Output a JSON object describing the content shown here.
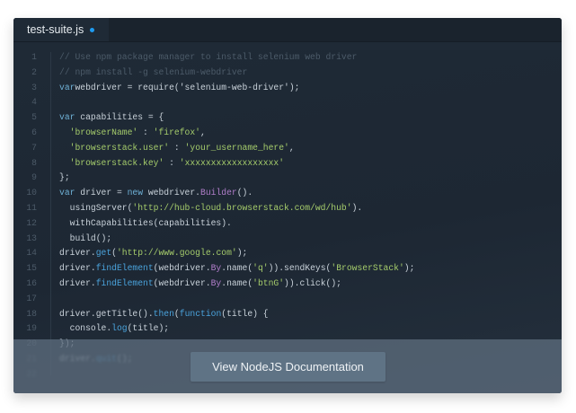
{
  "tab": {
    "filename": "test-suite.js",
    "modified_indicator_color": "#1e9bf0"
  },
  "colors": {
    "keyword": "#6fb1d6",
    "string": "#a5cc6b",
    "class": "#b07dc9",
    "method": "#4aa3dc",
    "comment": "#4c5b69"
  },
  "code": {
    "lines": [
      {
        "num": "1",
        "tokens": [
          [
            "c",
            "// Use npm package manager to install selenium web driver"
          ]
        ]
      },
      {
        "num": "2",
        "tokens": [
          [
            "c",
            "// npm install -g selenium-webdriver"
          ]
        ]
      },
      {
        "num": "3",
        "tokens": [
          [
            "k",
            "var"
          ],
          [
            "",
            "webdriver = require("
          ],
          [
            "",
            "'selenium-web-driver'"
          ],
          [
            "",
            ");"
          ]
        ]
      },
      {
        "num": "4",
        "tokens": []
      },
      {
        "num": "5",
        "tokens": [
          [
            "k",
            "var"
          ],
          [
            "",
            " capabilities = {"
          ]
        ]
      },
      {
        "num": "6",
        "tokens": [
          [
            "",
            "  "
          ],
          [
            "s",
            "'browserName'"
          ],
          [
            "",
            " : "
          ],
          [
            "s",
            "'firefox'"
          ],
          [
            "",
            ","
          ]
        ]
      },
      {
        "num": "7",
        "tokens": [
          [
            "",
            "  "
          ],
          [
            "s",
            "'browserstack.user'"
          ],
          [
            "",
            " : "
          ],
          [
            "s",
            "'your_username_here'"
          ],
          [
            "",
            ","
          ]
        ]
      },
      {
        "num": "8",
        "tokens": [
          [
            "",
            "  "
          ],
          [
            "s",
            "'browserstack.key'"
          ],
          [
            "",
            " : "
          ],
          [
            "s",
            "'xxxxxxxxxxxxxxxxxx'"
          ]
        ]
      },
      {
        "num": "9",
        "tokens": [
          [
            "",
            "};"
          ]
        ]
      },
      {
        "num": "10",
        "tokens": []
      },
      {
        "num": "11",
        "tokens": [
          [
            "k",
            "var"
          ],
          [
            "",
            " driver = "
          ],
          [
            "k",
            "new"
          ],
          [
            "",
            " webdriver."
          ],
          [
            "p",
            "Builder"
          ],
          [
            "",
            "()."
          ]
        ]
      },
      {
        "num": "12",
        "tokens": [
          [
            "",
            "  usingServer("
          ],
          [
            "s",
            "'http://hub-cloud.browserstack.com/wd/hub'"
          ],
          [
            "",
            ")."
          ]
        ]
      },
      {
        "num": "13",
        "tokens": [
          [
            "",
            "  withCapabilities(capabilities)."
          ]
        ]
      },
      {
        "num": "14",
        "tokens": [
          [
            "",
            "  build();"
          ]
        ]
      },
      {
        "num": "15",
        "tokens": []
      },
      {
        "num": "16",
        "tokens": [
          [
            "",
            "driver."
          ],
          [
            "f",
            "get"
          ],
          [
            "",
            "("
          ],
          [
            "s",
            "'http://www.google.com'"
          ],
          [
            "",
            ");"
          ]
        ]
      },
      {
        "num": "17",
        "tokens": [
          [
            "",
            "driver."
          ],
          [
            "f",
            "findElement"
          ],
          [
            "",
            "(webdriver."
          ],
          [
            "p",
            "By"
          ],
          [
            "",
            ".name("
          ],
          [
            "s",
            "'q'"
          ],
          [
            "",
            "))."
          ],
          [
            "",
            "sendKeys("
          ],
          [
            "s",
            "'BrowserStack'"
          ],
          [
            "",
            ");"
          ]
        ]
      },
      {
        "num": "18",
        "tokens": [
          [
            "",
            "driver."
          ],
          [
            "f",
            "findElement"
          ],
          [
            "",
            "(webdriver."
          ],
          [
            "p",
            "By"
          ],
          [
            "",
            ".name("
          ],
          [
            "s",
            "'btnG'"
          ],
          [
            "",
            ")).click();"
          ]
        ]
      },
      {
        "num": "19",
        "tokens": []
      },
      {
        "num": "20",
        "tokens": [
          [
            "",
            "driver.getTitle()."
          ],
          [
            "f",
            "then"
          ],
          [
            "",
            "("
          ],
          [
            "f",
            "function"
          ],
          [
            "",
            "(title) {"
          ]
        ]
      },
      {
        "num": "21",
        "tokens": [
          [
            "",
            "  console."
          ],
          [
            "f",
            "log"
          ],
          [
            "",
            "(title);"
          ]
        ]
      },
      {
        "num": "22",
        "tokens": [
          [
            "",
            "});"
          ]
        ]
      },
      {
        "num": "23",
        "tokens": []
      },
      {
        "num": "24",
        "tokens": [
          [
            "",
            "driver."
          ],
          [
            "f",
            "quit"
          ],
          [
            "",
            "();"
          ]
        ]
      },
      {
        "num": "25",
        "tokens": []
      }
    ]
  },
  "gutter_numbers": [
    "1",
    "2",
    "3",
    "4",
    "5",
    "6",
    "7",
    "8",
    "9",
    "10",
    "11",
    "12",
    "13",
    "14",
    "15",
    "16",
    "17",
    "18",
    "19",
    "20",
    "21",
    "22"
  ],
  "overlay": {
    "button_label": "View NodeJS Documentation"
  }
}
